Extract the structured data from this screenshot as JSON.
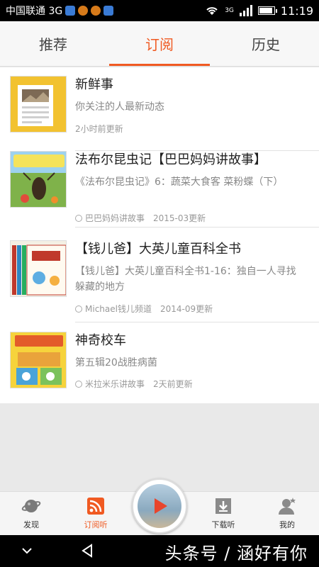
{
  "status_bar": {
    "carrier": "中国联通 3G",
    "network": "3G",
    "time": "11:19",
    "battery_level": 0.9
  },
  "tabs": [
    {
      "label": "推荐"
    },
    {
      "label": "订阅"
    },
    {
      "label": "历史"
    }
  ],
  "subscriptions": [
    {
      "title": "新鲜事",
      "desc": "你关注的人最新动态",
      "author": "",
      "updated": "2小时前更新",
      "thumb_icon": "news-icon"
    },
    {
      "title": "法布尔昆虫记【巴巴妈妈讲故事】",
      "desc": "《法布尔昆虫记》6：蔬菜大食客 菜粉蝶（下）",
      "author": "巴巴妈妈讲故事",
      "updated": "2015-03更新",
      "thumb_icon": "insect-book-cover-icon"
    },
    {
      "title": "【钱儿爸】大英儿童百科全书",
      "desc": "【钱儿爸】大英儿童百科全书1-16：独自一人寻找躲藏的地方",
      "author": "Michael钱儿频道",
      "updated": "2014-09更新",
      "thumb_icon": "encyclopedia-cover-icon"
    },
    {
      "title": "神奇校车",
      "desc": "第五辑20战胜病菌",
      "author": "米拉米乐讲故事",
      "updated": "2天前更新",
      "thumb_icon": "magic-school-bus-cover-icon"
    }
  ],
  "bottom_nav": [
    {
      "label": "发现",
      "icon": "planet-icon"
    },
    {
      "label": "订阅听",
      "icon": "rss-icon"
    },
    {
      "label": "下载听",
      "icon": "download-icon"
    },
    {
      "label": "我的",
      "icon": "user-icon"
    }
  ],
  "player": {
    "icon": "play-icon"
  },
  "watermark": "头条号 / 涵好有你",
  "colors": {
    "accent": "#f05a22",
    "text": "#222222",
    "secondary": "#888888"
  }
}
